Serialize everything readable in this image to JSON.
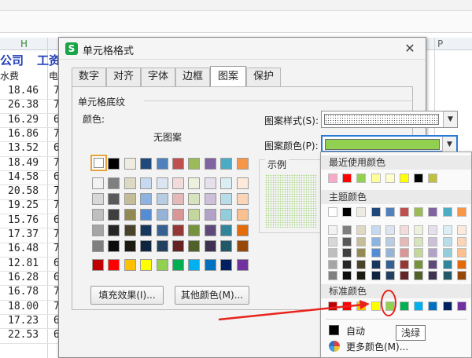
{
  "sheet": {
    "column_h": "H",
    "column_p": "P",
    "title_part1": "公司",
    "title_part2": "工资",
    "header_part1": "水费",
    "header_part2": "电",
    "values": [
      "18.46",
      "26.38",
      "16.29",
      "16.86",
      "13.52",
      "18.49",
      "14.58",
      "20.58",
      "19.25",
      "15.76",
      "17.37",
      "16.48",
      "12.81",
      "16.28",
      "16.78",
      "18.00",
      "17.23",
      "22.53"
    ],
    "second_col": [
      "7",
      "7",
      "6",
      "7",
      "6",
      "7",
      "6",
      "7",
      "7",
      "6",
      "7",
      "7",
      "6",
      "6",
      "7",
      "7",
      "6",
      "6"
    ]
  },
  "dialog": {
    "title": "单元格格式",
    "close": "✕",
    "tabs": [
      "数字",
      "对齐",
      "字体",
      "边框",
      "图案",
      "保护"
    ],
    "active_tab": "图案",
    "group_label": "单元格底纹",
    "color_label": "颜色:",
    "no_pattern": "无图案",
    "fill_effects_button": "填充效果(I)...",
    "other_colors_button": "其他颜色(M)...",
    "pattern_style_label": "图案样式(S):",
    "pattern_color_label": "图案颜色(P):",
    "sample_label": "示例"
  },
  "palette": {
    "recent_header": "最近使用颜色",
    "theme_header": "主题颜色",
    "standard_header": "标准颜色",
    "auto_label": "自动",
    "more_colors": "更多颜色(M)...",
    "tooltip": "浅绿",
    "recent_colors": [
      "#f9a9c8",
      "#ff0000",
      "#92d050",
      "#ffff99",
      "#ffffcc",
      "#ffff00",
      "#000000",
      "#c0c040"
    ],
    "theme_row1": [
      "#ffffff",
      "#000000",
      "#eeece1",
      "#1f497d",
      "#4f81bd",
      "#c0504d",
      "#9bbb59",
      "#8064a2",
      "#4bacc6",
      "#f79646"
    ],
    "theme_shades": [
      [
        "#f2f2f2",
        "#7f7f7f",
        "#ddd9c3",
        "#c6d9f0",
        "#dbe5f1",
        "#f2dcdb",
        "#ebf1dd",
        "#e5e0ec",
        "#dbeef3",
        "#fdeada"
      ],
      [
        "#d8d8d8",
        "#595959",
        "#c4bd97",
        "#8db3e2",
        "#b8cce4",
        "#e5b9b7",
        "#d7e3bc",
        "#ccc1d9",
        "#b7dde8",
        "#fbd5b5"
      ],
      [
        "#bfbfbf",
        "#3f3f3f",
        "#938953",
        "#548dd4",
        "#95b3d7",
        "#d99694",
        "#c3d69b",
        "#b2a2c7",
        "#92cddc",
        "#fac08f"
      ],
      [
        "#a5a5a5",
        "#262626",
        "#494429",
        "#17365d",
        "#366092",
        "#953734",
        "#76923c",
        "#5f497a",
        "#31859b",
        "#e36c09"
      ],
      [
        "#7f7f7f",
        "#0c0c0c",
        "#1d1b10",
        "#0f243e",
        "#244061",
        "#632423",
        "#4f6128",
        "#3f3151",
        "#205867",
        "#974806"
      ]
    ],
    "standard_colors": [
      "#c00000",
      "#ff0000",
      "#ffc000",
      "#ffff00",
      "#92d050",
      "#00b050",
      "#00b0f0",
      "#0070c0",
      "#002060",
      "#7030a0"
    ]
  },
  "dialog_palette": {
    "row1": [
      "#ffffff",
      "#000000",
      "#eeece1",
      "#1f497d",
      "#4f81bd",
      "#c0504d",
      "#9bbb59",
      "#8064a2",
      "#4bacc6",
      "#f79646"
    ],
    "shades": [
      [
        "#f2f2f2",
        "#7f7f7f",
        "#ddd9c3",
        "#c6d9f0",
        "#dbe5f1",
        "#f2dcdb",
        "#ebf1dd",
        "#e5e0ec",
        "#dbeef3",
        "#fdeada"
      ],
      [
        "#d8d8d8",
        "#595959",
        "#c4bd97",
        "#8db3e2",
        "#b8cce4",
        "#e5b9b7",
        "#d7e3bc",
        "#ccc1d9",
        "#b7dde8",
        "#fbd5b5"
      ],
      [
        "#bfbfbf",
        "#3f3f3f",
        "#938953",
        "#548dd4",
        "#95b3d7",
        "#d99694",
        "#c3d69b",
        "#b2a2c7",
        "#92cddc",
        "#fac08f"
      ],
      [
        "#a5a5a5",
        "#262626",
        "#494429",
        "#17365d",
        "#366092",
        "#953734",
        "#76923c",
        "#5f497a",
        "#31859b",
        "#e36c09"
      ],
      [
        "#7f7f7f",
        "#0c0c0c",
        "#1d1b10",
        "#0f243e",
        "#244061",
        "#632423",
        "#4f6128",
        "#3f3151",
        "#205867",
        "#974806"
      ]
    ],
    "standard": [
      "#c00000",
      "#ff0000",
      "#ffc000",
      "#ffff00",
      "#92d050",
      "#00b050",
      "#00b0f0",
      "#0070c0",
      "#002060",
      "#7030a0"
    ]
  }
}
